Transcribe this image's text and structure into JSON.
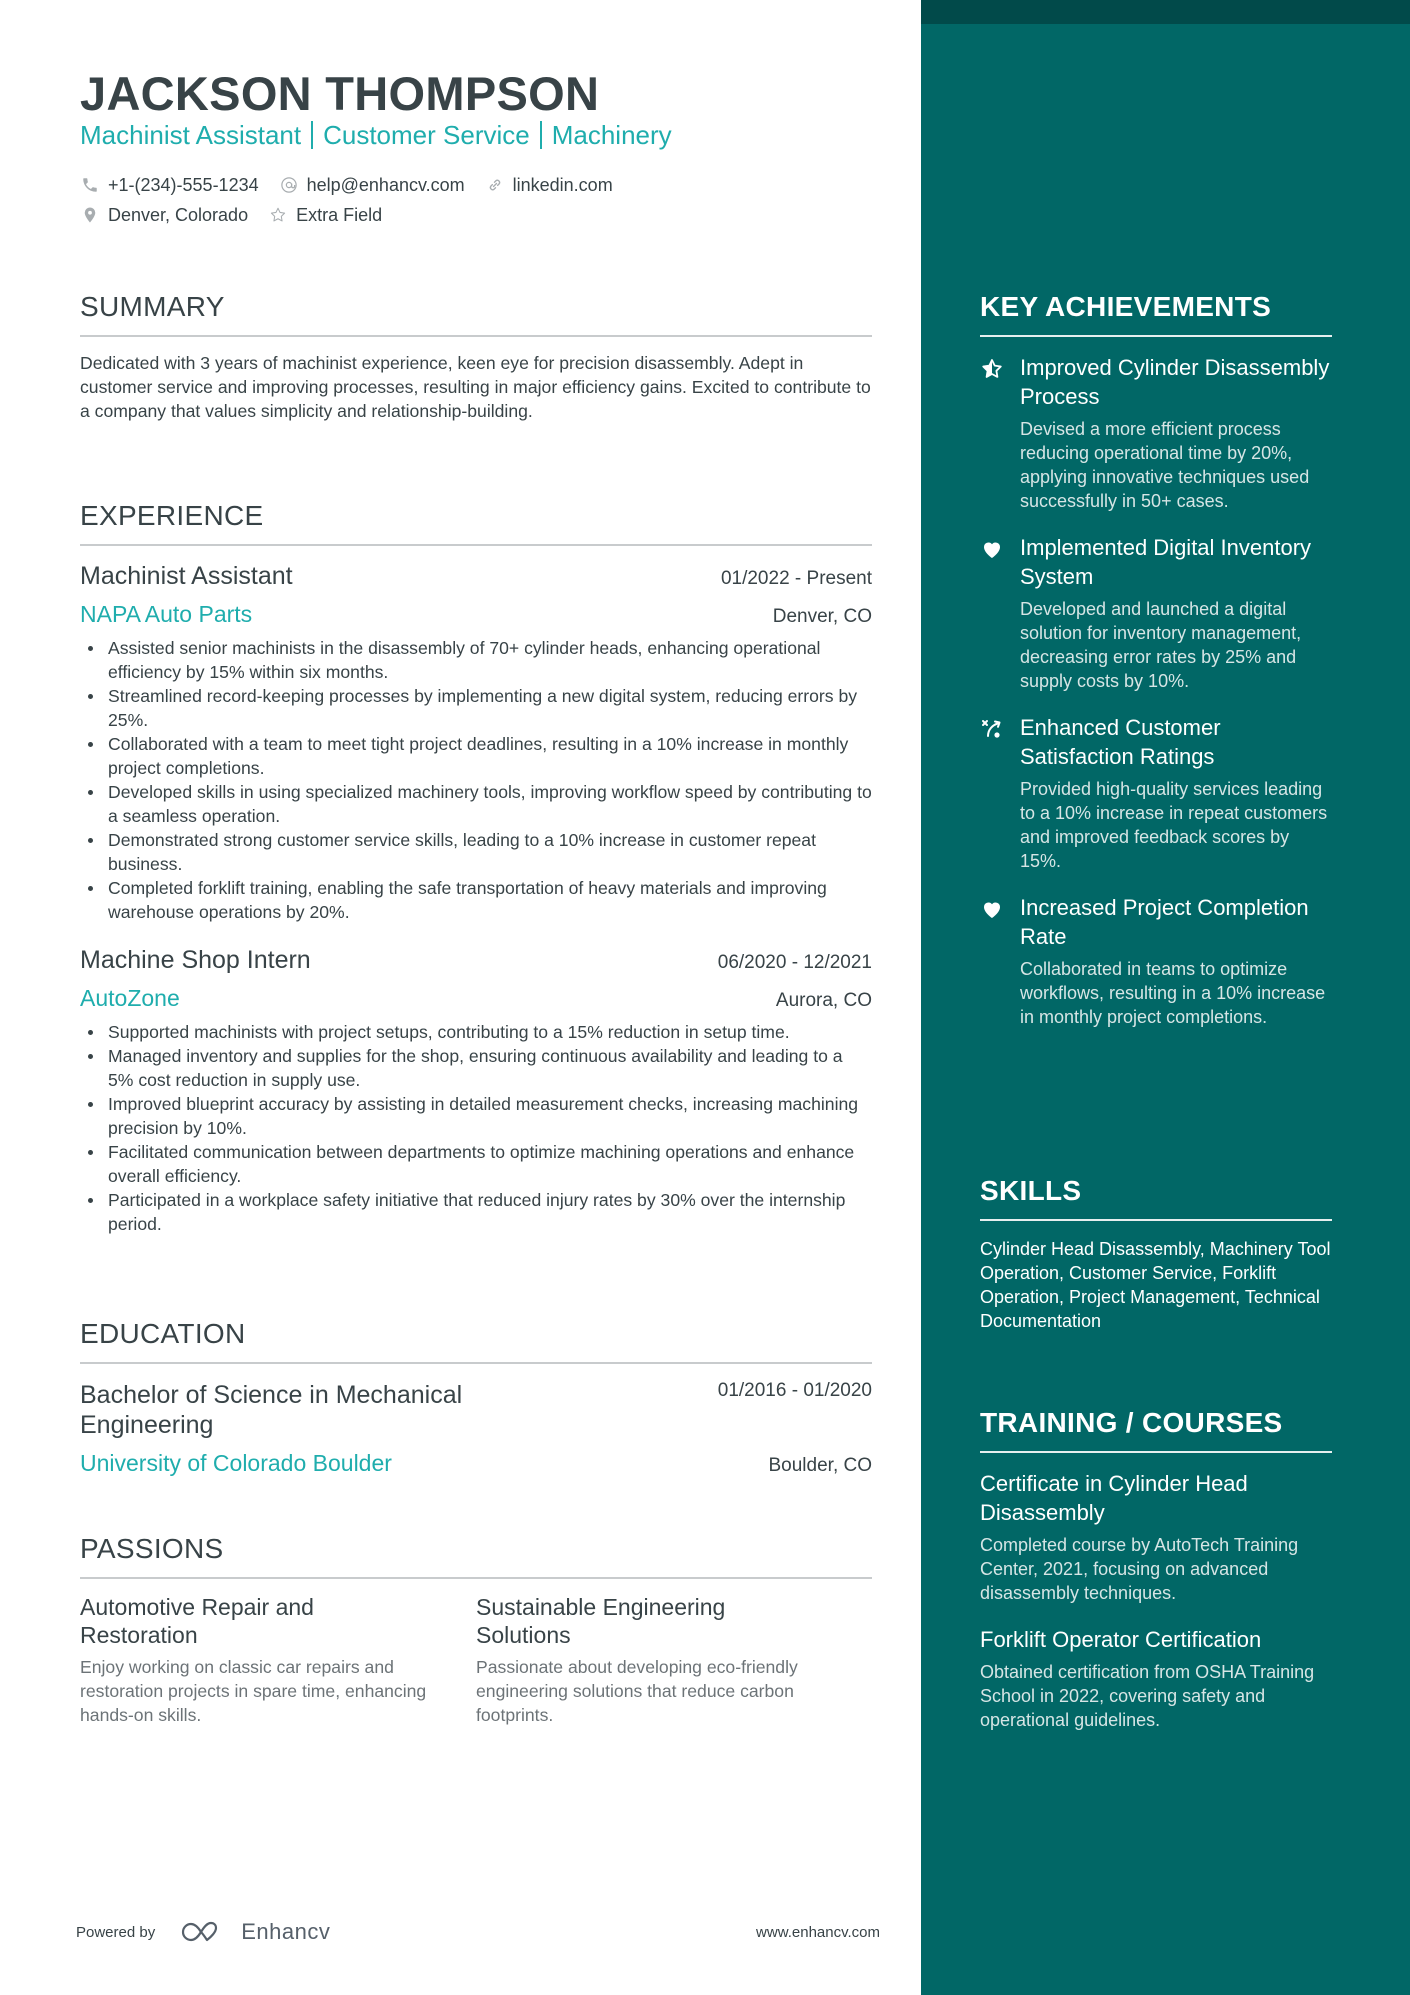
{
  "header": {
    "name": "JACKSON THOMPSON",
    "headline": [
      "Machinist Assistant",
      "Customer Service",
      "Machinery"
    ],
    "contacts": {
      "phone": "+1-(234)-555-1234",
      "email": "help@enhancv.com",
      "linkedin": "linkedin.com",
      "location": "Denver, Colorado",
      "extra": "Extra Field"
    },
    "icons": {
      "phone": "phone-icon",
      "email": "at-icon",
      "linkedin": "link-icon",
      "location": "map-pin-icon",
      "extra": "star-outline-icon"
    }
  },
  "summary": {
    "title": "SUMMARY",
    "text": "Dedicated with 3 years of machinist experience, keen eye for precision disassembly. Adept in customer service and improving processes, resulting in major efficiency gains. Excited to contribute to a company that values simplicity and relationship-building."
  },
  "experience": {
    "title": "EXPERIENCE",
    "jobs": [
      {
        "title": "Machinist Assistant",
        "dates": "01/2022 - Present",
        "company": "NAPA Auto Parts",
        "location": "Denver, CO",
        "bullets": [
          "Assisted senior machinists in the disassembly of 70+ cylinder heads, enhancing operational efficiency by 15% within six months.",
          "Streamlined record-keeping processes by implementing a new digital system, reducing errors by 25%.",
          "Collaborated with a team to meet tight project deadlines, resulting in a 10% increase in monthly project completions.",
          "Developed skills in using specialized machinery tools, improving workflow speed by contributing to a seamless operation.",
          "Demonstrated strong customer service skills, leading to a 10% increase in customer repeat business.",
          "Completed forklift training, enabling the safe transportation of heavy materials and improving warehouse operations by 20%."
        ]
      },
      {
        "title": "Machine Shop Intern",
        "dates": "06/2020 - 12/2021",
        "company": "AutoZone",
        "location": "Aurora, CO",
        "bullets": [
          "Supported machinists with project setups, contributing to a 15% reduction in setup time.",
          "Managed inventory and supplies for the shop, ensuring continuous availability and leading to a 5% cost reduction in supply use.",
          "Improved blueprint accuracy by assisting in detailed measurement checks, increasing machining precision by 10%.",
          "Facilitated communication between departments to optimize machining operations and enhance overall efficiency.",
          "Participated in a workplace safety initiative that reduced injury rates by 30% over the internship period."
        ]
      }
    ]
  },
  "education": {
    "title": "EDUCATION",
    "items": [
      {
        "degree": "Bachelor of Science in Mechanical Engineering",
        "dates": "01/2016 - 01/2020",
        "school": "University of Colorado Boulder",
        "location": "Boulder, CO"
      }
    ]
  },
  "passions": {
    "title": "PASSIONS",
    "items": [
      {
        "title": "Automotive Repair and Restoration",
        "description": "Enjoy working on classic car repairs and restoration projects in spare time, enhancing hands-on skills."
      },
      {
        "title": "Sustainable Engineering Solutions",
        "description": "Passionate about developing eco-friendly engineering solutions that reduce carbon footprints."
      }
    ]
  },
  "achievements": {
    "title": "KEY ACHIEVEMENTS",
    "items": [
      {
        "icon": "star-half-icon",
        "title": "Improved Cylinder Disassembly Process",
        "description": "Devised a more efficient process reducing operational time by 20%, applying innovative techniques used successfully in 50+ cases."
      },
      {
        "icon": "heart-icon",
        "title": "Implemented Digital Inventory System",
        "description": "Developed and launched a digital solution for inventory management, decreasing error rates by 25% and supply costs by 10%."
      },
      {
        "icon": "strategy-icon",
        "title": "Enhanced Customer Satisfaction Ratings",
        "description": "Provided high-quality services leading to a 10% increase in repeat customers and improved feedback scores by 15%."
      },
      {
        "icon": "heart-icon",
        "title": "Increased Project Completion Rate",
        "description": "Collaborated in teams to optimize workflows, resulting in a 10% increase in monthly project completions."
      }
    ]
  },
  "skills": {
    "title": "SKILLS",
    "text": "Cylinder Head Disassembly, Machinery Tool Operation, Customer Service, Forklift Operation, Project Management, Technical Documentation"
  },
  "training": {
    "title": "TRAINING / COURSES",
    "items": [
      {
        "title": "Certificate in Cylinder Head Disassembly",
        "description": "Completed course by AutoTech Training Center, 2021, focusing on advanced disassembly techniques."
      },
      {
        "title": "Forklift Operator Certification",
        "description": "Obtained certification from OSHA Training School in 2022, covering safety and operational guidelines."
      }
    ]
  },
  "footer": {
    "powered_by": "Powered by",
    "brand": "Enhancv",
    "website": "www.enhancv.com"
  },
  "colors": {
    "accent": "#1fadad",
    "sidebar": "#016766",
    "sidebar_top": "#014a4a",
    "text": "#384347"
  }
}
